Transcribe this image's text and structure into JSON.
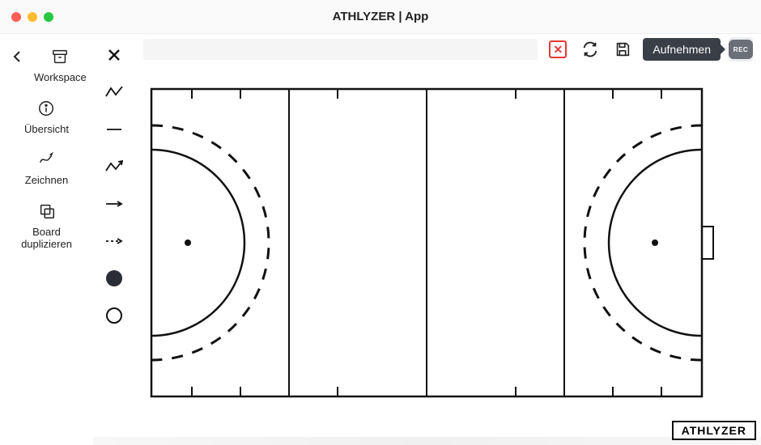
{
  "window": {
    "title": "ATHLYZER | App"
  },
  "sidebar": {
    "workspace": {
      "label": "Workspace"
    },
    "overview": {
      "label": "Übersicht"
    },
    "draw": {
      "label": "Zeichnen"
    },
    "duplicate": {
      "label": "Board\nduplizieren"
    }
  },
  "tools": {
    "close": "close",
    "polyline": "polyline",
    "line": "line",
    "arrow_poly": "arrow-polyline",
    "arrow": "arrow",
    "arrow_dashed": "arrow-dashed",
    "dot_filled": "dot-filled",
    "dot_hollow": "dot-hollow"
  },
  "topbar": {
    "cancel": "×",
    "refresh": "refresh",
    "save": "save",
    "record_tooltip": "Aufnehmen",
    "rec_chip": "REC"
  },
  "brand": "ATHLYZER"
}
